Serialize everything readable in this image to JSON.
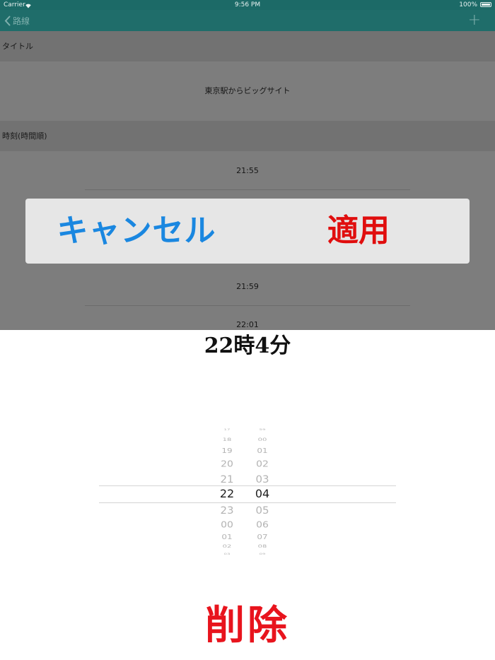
{
  "status_bar": {
    "carrier": "Carrier",
    "time": "9:56 PM",
    "battery": "100%",
    "wifi_icon": "wifi-icon",
    "battery_icon": "battery-icon"
  },
  "nav": {
    "back_label": "路線",
    "back_icon": "chevron-left-icon",
    "add_label": "+"
  },
  "sections": {
    "title_header": "タイトル",
    "title_value": "東京駅からビッグサイト",
    "times_header": "時刻(時間順)"
  },
  "times": [
    "21:55",
    "21:59",
    "22:01"
  ],
  "alert": {
    "cancel_label": "キャンセル",
    "apply_label": "適用"
  },
  "picker": {
    "title": "22時4分",
    "hours": [
      "17",
      "18",
      "19",
      "20",
      "21",
      "22",
      "23",
      "00",
      "01",
      "02",
      "03"
    ],
    "minutes": [
      "59",
      "00",
      "01",
      "02",
      "03",
      "04",
      "05",
      "06",
      "07",
      "08",
      "09"
    ],
    "selected_hour": "22",
    "selected_minute": "04"
  },
  "delete_label": "削除",
  "colors": {
    "nav_bg": "#1f6d6a",
    "cancel": "#1a87e0",
    "apply": "#e00e0e",
    "delete": "#e8141d"
  }
}
